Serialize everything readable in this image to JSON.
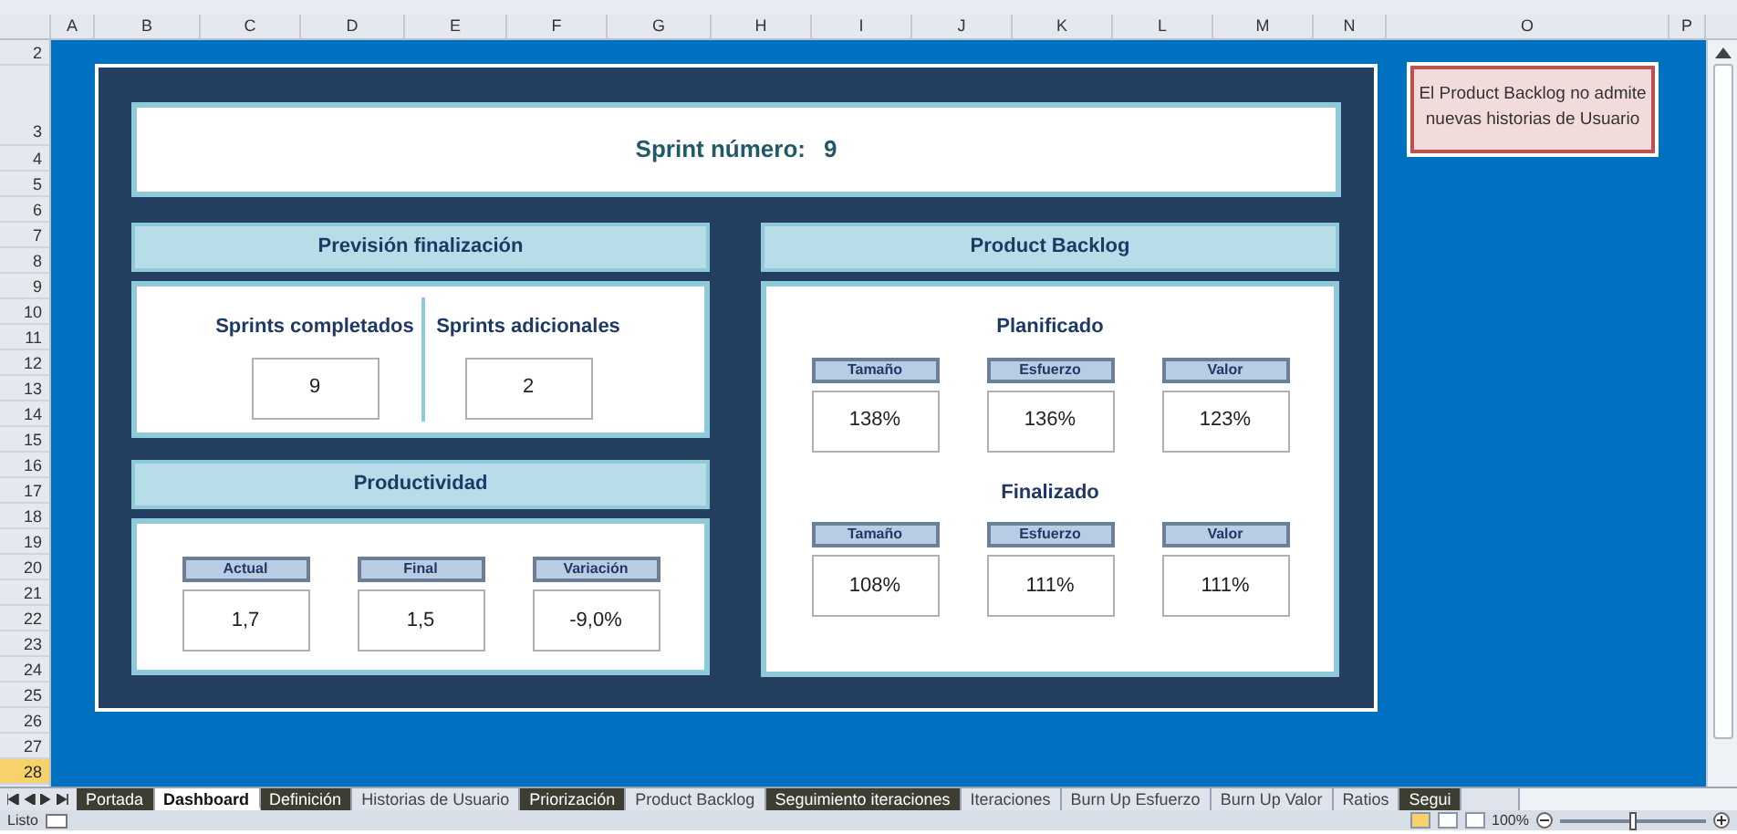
{
  "columns": [
    "A",
    "B",
    "C",
    "D",
    "E",
    "F",
    "G",
    "H",
    "I",
    "J",
    "K",
    "L",
    "M",
    "N",
    "O",
    "P"
  ],
  "rows": [
    {
      "label": "2",
      "selected": false
    },
    {
      "label": "3",
      "selected": false
    },
    {
      "label": "4",
      "selected": false
    },
    {
      "label": "5",
      "selected": false
    },
    {
      "label": "6",
      "selected": false
    },
    {
      "label": "7",
      "selected": false
    },
    {
      "label": "8",
      "selected": false
    },
    {
      "label": "9",
      "selected": false
    },
    {
      "label": "10",
      "selected": false
    },
    {
      "label": "11",
      "selected": false
    },
    {
      "label": "12",
      "selected": false
    },
    {
      "label": "13",
      "selected": false
    },
    {
      "label": "14",
      "selected": false
    },
    {
      "label": "15",
      "selected": false
    },
    {
      "label": "16",
      "selected": false
    },
    {
      "label": "17",
      "selected": false
    },
    {
      "label": "18",
      "selected": false
    },
    {
      "label": "19",
      "selected": false
    },
    {
      "label": "20",
      "selected": false
    },
    {
      "label": "21",
      "selected": false
    },
    {
      "label": "22",
      "selected": false
    },
    {
      "label": "23",
      "selected": false
    },
    {
      "label": "24",
      "selected": false
    },
    {
      "label": "25",
      "selected": false
    },
    {
      "label": "26",
      "selected": false
    },
    {
      "label": "27",
      "selected": false
    },
    {
      "label": "28",
      "selected": true
    }
  ],
  "dashboard": {
    "sprint": {
      "label": "Sprint número:",
      "value": "9"
    },
    "forecast": {
      "title": "Previsión finalización",
      "items": [
        {
          "label": "Sprints completados",
          "value": "9"
        },
        {
          "label": "Sprints adicionales",
          "value": "2"
        }
      ]
    },
    "productivity": {
      "title": "Productividad",
      "metrics": [
        {
          "label": "Actual",
          "value": "1,7"
        },
        {
          "label": "Final",
          "value": "1,5"
        },
        {
          "label": "Variación",
          "value": "-9,0%"
        }
      ]
    },
    "backlog": {
      "title": "Product Backlog",
      "groups": [
        {
          "title": "Planificado",
          "metrics": [
            {
              "label": "Tamaño",
              "value": "138%"
            },
            {
              "label": "Esfuerzo",
              "value": "136%"
            },
            {
              "label": "Valor",
              "value": "123%"
            }
          ]
        },
        {
          "title": "Finalizado",
          "metrics": [
            {
              "label": "Tamaño",
              "value": "108%"
            },
            {
              "label": "Esfuerzo",
              "value": "111%"
            },
            {
              "label": "Valor",
              "value": "111%"
            }
          ]
        }
      ]
    }
  },
  "note": "El Product Backlog no admite nuevas historias de Usuario",
  "sheet_tabs": [
    {
      "label": "Portada",
      "selected": false,
      "color": "#3d3d32"
    },
    {
      "label": "Dashboard",
      "selected": true
    },
    {
      "label": "Definición",
      "selected": false,
      "color": "#3d3d32"
    },
    {
      "label": "Historias de Usuario",
      "selected": false
    },
    {
      "label": "Priorización",
      "selected": false,
      "color": "#3d3d32"
    },
    {
      "label": "Product Backlog",
      "selected": false
    },
    {
      "label": "Seguimiento iteraciones",
      "selected": false,
      "color": "#3d3d32"
    },
    {
      "label": "Iteraciones",
      "selected": false
    },
    {
      "label": "Burn Up Esfuerzo",
      "selected": false
    },
    {
      "label": "Burn Up Valor",
      "selected": false
    },
    {
      "label": "Ratios",
      "selected": false
    },
    {
      "label": "Segui",
      "selected": false,
      "color": "#3d3d32"
    }
  ],
  "status_bar": {
    "text": "Listo",
    "zoom": "100%",
    "zoom_slider": {
      "level": 0.5
    }
  }
}
